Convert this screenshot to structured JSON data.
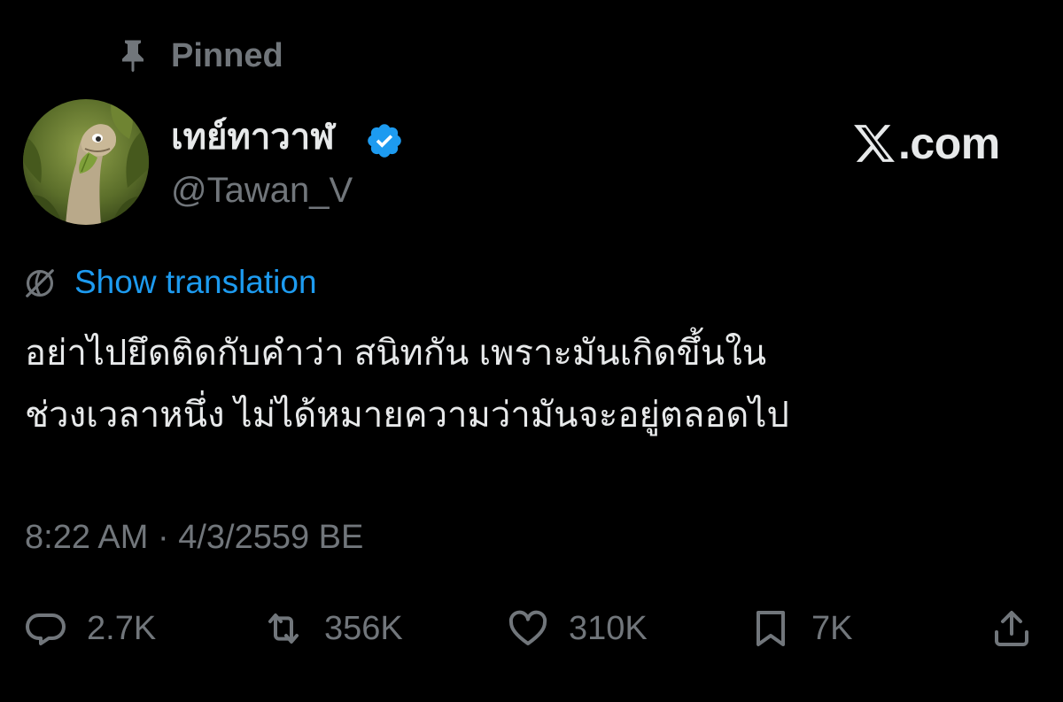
{
  "pinned": {
    "label": "Pinned",
    "icon": "pin-icon"
  },
  "author": {
    "display_name": "เทย์ทาวาฬ",
    "handle": "@Tawan_V",
    "verified_color": "#1d9bf0"
  },
  "watermark": {
    "text": ".com"
  },
  "translation": {
    "label": "Show translation",
    "icon": "globe-icon"
  },
  "tweet": {
    "lines": [
      "อย่าไปยึดติดกับคำว่า สนิทกัน เพราะมันเกิดขึ้นใน",
      "ช่วงเวลาหนึ่ง ไม่ได้หมายความว่ามันจะอยู่ตลอดไป"
    ]
  },
  "timestamp": "8:22 AM · 4/3/2559 BE",
  "actions": {
    "replies": "2.7K",
    "reposts": "356K",
    "likes": "310K",
    "bookmarks": "7K"
  },
  "colors": {
    "background": "#000000",
    "text": "#e7e9ea",
    "muted": "#71767b",
    "link": "#1d9bf0"
  }
}
